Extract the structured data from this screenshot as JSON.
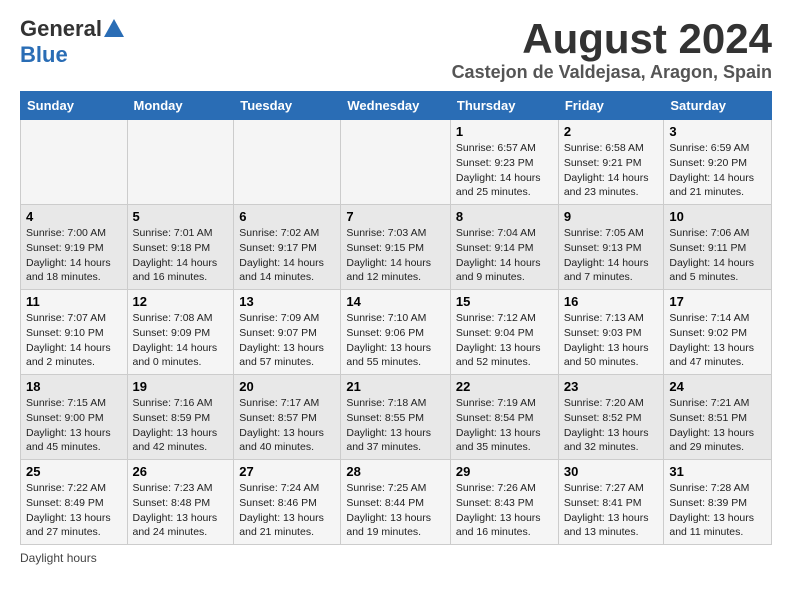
{
  "logo": {
    "general": "General",
    "blue": "Blue"
  },
  "title": {
    "month": "August 2024",
    "location": "Castejon de Valdejasa, Aragon, Spain"
  },
  "headers": [
    "Sunday",
    "Monday",
    "Tuesday",
    "Wednesday",
    "Thursday",
    "Friday",
    "Saturday"
  ],
  "weeks": [
    [
      {
        "day": "",
        "detail": ""
      },
      {
        "day": "",
        "detail": ""
      },
      {
        "day": "",
        "detail": ""
      },
      {
        "day": "",
        "detail": ""
      },
      {
        "day": "1",
        "detail": "Sunrise: 6:57 AM\nSunset: 9:23 PM\nDaylight: 14 hours and 25 minutes."
      },
      {
        "day": "2",
        "detail": "Sunrise: 6:58 AM\nSunset: 9:21 PM\nDaylight: 14 hours and 23 minutes."
      },
      {
        "day": "3",
        "detail": "Sunrise: 6:59 AM\nSunset: 9:20 PM\nDaylight: 14 hours and 21 minutes."
      }
    ],
    [
      {
        "day": "4",
        "detail": "Sunrise: 7:00 AM\nSunset: 9:19 PM\nDaylight: 14 hours and 18 minutes."
      },
      {
        "day": "5",
        "detail": "Sunrise: 7:01 AM\nSunset: 9:18 PM\nDaylight: 14 hours and 16 minutes."
      },
      {
        "day": "6",
        "detail": "Sunrise: 7:02 AM\nSunset: 9:17 PM\nDaylight: 14 hours and 14 minutes."
      },
      {
        "day": "7",
        "detail": "Sunrise: 7:03 AM\nSunset: 9:15 PM\nDaylight: 14 hours and 12 minutes."
      },
      {
        "day": "8",
        "detail": "Sunrise: 7:04 AM\nSunset: 9:14 PM\nDaylight: 14 hours and 9 minutes."
      },
      {
        "day": "9",
        "detail": "Sunrise: 7:05 AM\nSunset: 9:13 PM\nDaylight: 14 hours and 7 minutes."
      },
      {
        "day": "10",
        "detail": "Sunrise: 7:06 AM\nSunset: 9:11 PM\nDaylight: 14 hours and 5 minutes."
      }
    ],
    [
      {
        "day": "11",
        "detail": "Sunrise: 7:07 AM\nSunset: 9:10 PM\nDaylight: 14 hours and 2 minutes."
      },
      {
        "day": "12",
        "detail": "Sunrise: 7:08 AM\nSunset: 9:09 PM\nDaylight: 14 hours and 0 minutes."
      },
      {
        "day": "13",
        "detail": "Sunrise: 7:09 AM\nSunset: 9:07 PM\nDaylight: 13 hours and 57 minutes."
      },
      {
        "day": "14",
        "detail": "Sunrise: 7:10 AM\nSunset: 9:06 PM\nDaylight: 13 hours and 55 minutes."
      },
      {
        "day": "15",
        "detail": "Sunrise: 7:12 AM\nSunset: 9:04 PM\nDaylight: 13 hours and 52 minutes."
      },
      {
        "day": "16",
        "detail": "Sunrise: 7:13 AM\nSunset: 9:03 PM\nDaylight: 13 hours and 50 minutes."
      },
      {
        "day": "17",
        "detail": "Sunrise: 7:14 AM\nSunset: 9:02 PM\nDaylight: 13 hours and 47 minutes."
      }
    ],
    [
      {
        "day": "18",
        "detail": "Sunrise: 7:15 AM\nSunset: 9:00 PM\nDaylight: 13 hours and 45 minutes."
      },
      {
        "day": "19",
        "detail": "Sunrise: 7:16 AM\nSunset: 8:59 PM\nDaylight: 13 hours and 42 minutes."
      },
      {
        "day": "20",
        "detail": "Sunrise: 7:17 AM\nSunset: 8:57 PM\nDaylight: 13 hours and 40 minutes."
      },
      {
        "day": "21",
        "detail": "Sunrise: 7:18 AM\nSunset: 8:55 PM\nDaylight: 13 hours and 37 minutes."
      },
      {
        "day": "22",
        "detail": "Sunrise: 7:19 AM\nSunset: 8:54 PM\nDaylight: 13 hours and 35 minutes."
      },
      {
        "day": "23",
        "detail": "Sunrise: 7:20 AM\nSunset: 8:52 PM\nDaylight: 13 hours and 32 minutes."
      },
      {
        "day": "24",
        "detail": "Sunrise: 7:21 AM\nSunset: 8:51 PM\nDaylight: 13 hours and 29 minutes."
      }
    ],
    [
      {
        "day": "25",
        "detail": "Sunrise: 7:22 AM\nSunset: 8:49 PM\nDaylight: 13 hours and 27 minutes."
      },
      {
        "day": "26",
        "detail": "Sunrise: 7:23 AM\nSunset: 8:48 PM\nDaylight: 13 hours and 24 minutes."
      },
      {
        "day": "27",
        "detail": "Sunrise: 7:24 AM\nSunset: 8:46 PM\nDaylight: 13 hours and 21 minutes."
      },
      {
        "day": "28",
        "detail": "Sunrise: 7:25 AM\nSunset: 8:44 PM\nDaylight: 13 hours and 19 minutes."
      },
      {
        "day": "29",
        "detail": "Sunrise: 7:26 AM\nSunset: 8:43 PM\nDaylight: 13 hours and 16 minutes."
      },
      {
        "day": "30",
        "detail": "Sunrise: 7:27 AM\nSunset: 8:41 PM\nDaylight: 13 hours and 13 minutes."
      },
      {
        "day": "31",
        "detail": "Sunrise: 7:28 AM\nSunset: 8:39 PM\nDaylight: 13 hours and 11 minutes."
      }
    ]
  ],
  "footer": {
    "daylight_label": "Daylight hours"
  }
}
